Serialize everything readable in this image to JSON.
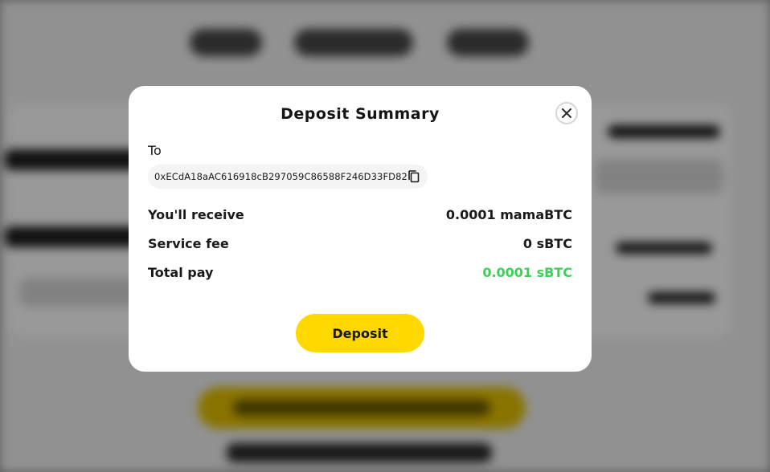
{
  "modal": {
    "title": "Deposit Summary",
    "to_label": "To",
    "address": "0xECdA18aAC616918cB297059C86588F246D33FD82",
    "rows": [
      {
        "label": "You'll receive",
        "value": "0.0001 mamaBTC"
      },
      {
        "label": "Service fee",
        "value": "0 sBTC"
      },
      {
        "label": "Total pay",
        "value": "0.0001 sBTC"
      }
    ],
    "deposit_label": "Deposit",
    "close_icon": "close-icon",
    "copy_icon": "copy-icon"
  },
  "colors": {
    "accent_yellow": "#ffd800",
    "total_green": "#39d353"
  }
}
